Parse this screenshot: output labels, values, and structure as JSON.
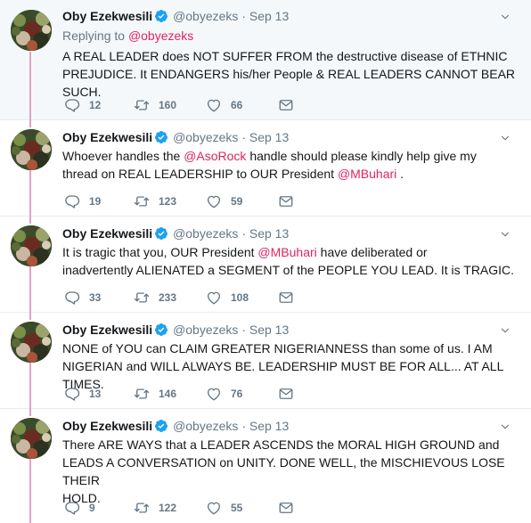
{
  "author": {
    "name": "Oby Ezekwesili",
    "handle": "@obyezeks"
  },
  "accent_color": "#e0245e",
  "thread_color": "#e0a3c3",
  "tweets": [
    {
      "time": "Sep 13",
      "replying_prefix": "Replying to",
      "replying_to": "@obyezeks",
      "line1": "A REAL LEADER does NOT SUFFER FROM the destructive disease of ETHNIC",
      "line2": "PREJUDICE. It ENDANGERS his/her People & REAL LEADERS CANNOT BEAR SUCH.",
      "replies": "12",
      "retweets": "160",
      "likes": "66"
    },
    {
      "time": "Sep 13",
      "l1a": "Whoever handles the ",
      "l1m": "@AsoRock",
      "l1b": " handle should please kindly help give my",
      "l2a": "thread on REAL LEADERSHIP to OUR President ",
      "l2m": "@MBuhari",
      "l2b": " .",
      "replies": "19",
      "retweets": "123",
      "likes": "59"
    },
    {
      "time": "Sep 13",
      "l1a": "It is tragic that you, OUR President ",
      "l1m": "@MBuhari",
      "l1b": " have deliberated or",
      "line2": "inadvertently ALIENATED a SEGMENT of the PEOPLE YOU LEAD. It is TRAGIC.",
      "replies": "33",
      "retweets": "233",
      "likes": "108"
    },
    {
      "time": "Sep 13",
      "line1": "NONE of YOU can CLAIM GREATER NIGERIANNESS than some of us. I AM",
      "line2": "NIGERIAN and WILL ALWAYS BE. LEADERSHIP MUST BE FOR ALL... AT ALL TIMES.",
      "replies": "13",
      "retweets": "146",
      "likes": "76"
    },
    {
      "time": "Sep 13",
      "line1": "There ARE WAYS that a LEADER ASCENDS the MORAL HIGH GROUND and",
      "line2": "LEADS A CONVERSATION on UNITY. DONE WELL, the MISCHIEVOUS LOSE THEIR",
      "line3": "HOLD.",
      "replies": "9",
      "retweets": "122",
      "likes": "55"
    }
  ]
}
